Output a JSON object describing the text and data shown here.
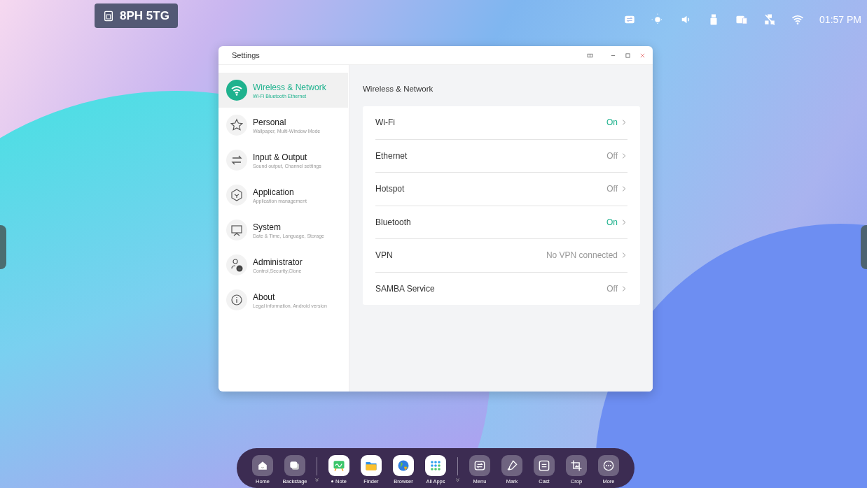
{
  "device_badge": {
    "text": "8PH 5TG"
  },
  "status_bar": {
    "time": "01:57 PM"
  },
  "window": {
    "title": "Settings"
  },
  "sidebar": {
    "items": [
      {
        "title": "Wireless & Network",
        "subtitle": "Wi-Fi Bluetooth Ethernet",
        "selected": true
      },
      {
        "title": "Personal",
        "subtitle": "Wallpaper, Multi-Window Mode",
        "selected": false
      },
      {
        "title": "Input & Output",
        "subtitle": "Sound output, Channel settings",
        "selected": false
      },
      {
        "title": "Application",
        "subtitle": "Application management",
        "selected": false
      },
      {
        "title": "System",
        "subtitle": "Date & Time, Language, Storage",
        "selected": false
      },
      {
        "title": "Administrator",
        "subtitle": "Control,Security,Clone",
        "selected": false
      },
      {
        "title": "About",
        "subtitle": "Legal information, Android version",
        "selected": false
      }
    ]
  },
  "content": {
    "heading": "Wireless & Network",
    "rows": [
      {
        "label": "Wi-Fi",
        "value": "On",
        "on": true
      },
      {
        "label": "Ethernet",
        "value": "Off",
        "on": false
      },
      {
        "label": "Hotspot",
        "value": "Off",
        "on": false
      },
      {
        "label": "Bluetooth",
        "value": "On",
        "on": true
      },
      {
        "label": "VPN",
        "value": "No VPN connected",
        "on": false
      },
      {
        "label": "SAMBA Service",
        "value": "Off",
        "on": false
      }
    ]
  },
  "dock": {
    "items": [
      {
        "label": "Home",
        "kind": "system",
        "running": false
      },
      {
        "label": "Backstage",
        "kind": "system",
        "running": false
      },
      {
        "label": "Note",
        "kind": "app",
        "running": true
      },
      {
        "label": "Finder",
        "kind": "app",
        "running": false
      },
      {
        "label": "Browser",
        "kind": "app",
        "running": false
      },
      {
        "label": "All Apps",
        "kind": "app",
        "running": false
      },
      {
        "label": "Menu",
        "kind": "tool",
        "running": false
      },
      {
        "label": "Mark",
        "kind": "tool",
        "running": false
      },
      {
        "label": "Cast",
        "kind": "tool",
        "running": false
      },
      {
        "label": "Crop",
        "kind": "tool",
        "running": false
      },
      {
        "label": "More",
        "kind": "tool",
        "running": false
      }
    ]
  }
}
